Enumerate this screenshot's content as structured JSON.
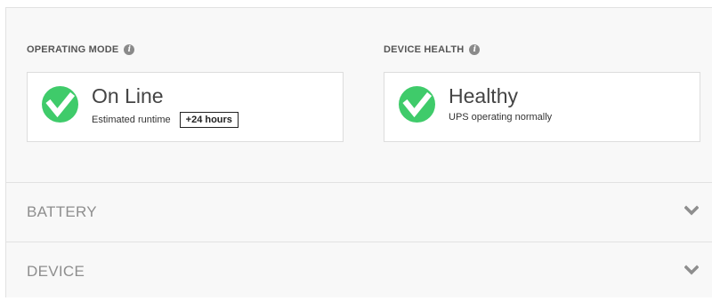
{
  "operating_mode": {
    "label": "OPERATING MODE",
    "info_icon": "info-icon",
    "status": "On Line",
    "detail": "Estimated runtime",
    "runtime": "+24 hours",
    "status_icon": "check-circle-icon"
  },
  "device_health": {
    "label": "DEVICE HEALTH",
    "info_icon": "info-icon",
    "status": "Healthy",
    "detail": "UPS operating normally",
    "status_icon": "check-circle-icon"
  },
  "sections": [
    {
      "label": "BATTERY",
      "icon": "chevron-down-icon"
    },
    {
      "label": "DEVICE",
      "icon": "chevron-down-icon"
    }
  ],
  "colors": {
    "ok_green": "#3fcb6a",
    "panel_bg": "#f8f8f8",
    "muted_text": "#8e8e8e"
  },
  "info_glyph": "i"
}
